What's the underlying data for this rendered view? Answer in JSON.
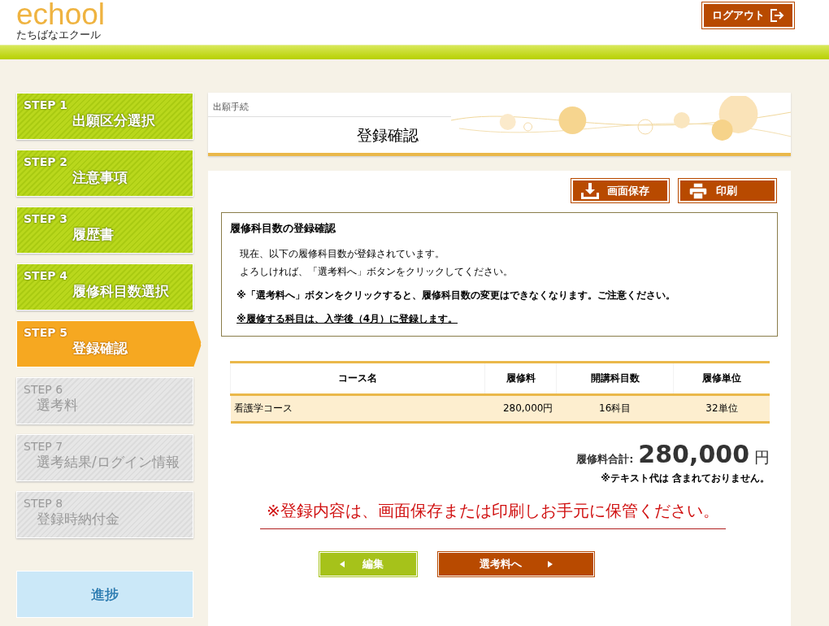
{
  "header": {
    "logo": "echool",
    "logo_subtitle": "たちばなエクール",
    "logout": "ログアウト"
  },
  "steps": [
    {
      "step": "STEP 1",
      "label": "出願区分選択",
      "selected": false,
      "disabled": false
    },
    {
      "step": "STEP 2",
      "label": "注意事項",
      "selected": false,
      "disabled": false
    },
    {
      "step": "STEP 3",
      "label": "履歴書",
      "selected": false,
      "disabled": false
    },
    {
      "step": "STEP 4",
      "label": "履修科目数選択",
      "selected": false,
      "disabled": false
    },
    {
      "step": "STEP 5",
      "label": "登録確認",
      "selected": true,
      "disabled": false
    },
    {
      "step": "STEP 6",
      "label": "選考料",
      "selected": false,
      "disabled": true
    },
    {
      "step": "STEP 7",
      "label": "選考結果/ログイン情報",
      "selected": false,
      "disabled": true
    },
    {
      "step": "STEP 8",
      "label": "登録時納付金",
      "selected": false,
      "disabled": true
    }
  ],
  "progress_button": "進捗",
  "page_header": {
    "breadcrumb": "出願手続",
    "title": "登録確認"
  },
  "toolbar": {
    "save": "画面保存",
    "print": "印刷"
  },
  "info_box": {
    "title": "履修科目数の登録確認",
    "notes": [
      {
        "kind": "plain",
        "text": "現在、以下の履修科目数が登録されています。"
      },
      {
        "kind": "plain",
        "text": "よろしければ、「選考料へ」ボタンをクリックしてください。"
      },
      {
        "kind": "bold",
        "text": "※「選考料へ」ボタンをクリックすると、履修科目数の変更はできなくなります。ご注意ください。"
      },
      {
        "kind": "underline",
        "text": "※履修する科目は、入学後（4月）に登録します。"
      }
    ]
  },
  "table": {
    "columns": [
      "コース名",
      "履修料",
      "開講科目数",
      "履修単位"
    ],
    "rows": [
      [
        "看護学コース",
        "280,000円",
        "16科目",
        "32単位"
      ]
    ]
  },
  "total": {
    "label": "履修料合計:",
    "amount": "280,000",
    "unit": "円",
    "note": "※テキスト代は 含まれておりません。"
  },
  "warning": "※登録内容は、画面保存または印刷しお手元に保管ください。",
  "buttons": {
    "back": "編集",
    "next": "選考料へ"
  }
}
